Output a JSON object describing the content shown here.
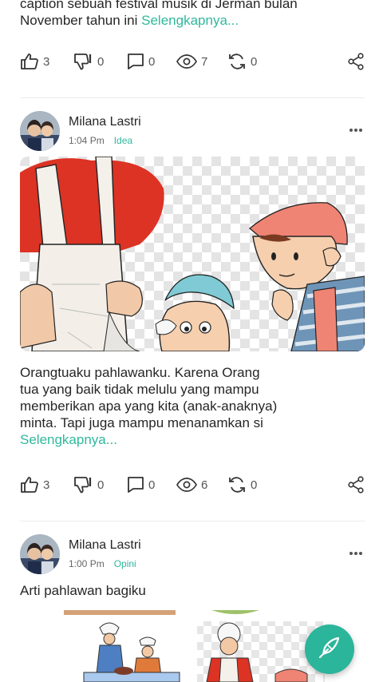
{
  "post1": {
    "caption_top": "caption sebuah festival musik di Jerman bulan",
    "caption_line2": "November tahun ini ",
    "more_label": "Selengkapnya...",
    "stats": {
      "likes": "3",
      "dislikes": "0",
      "comments": "0",
      "views": "7",
      "reposts": "0"
    }
  },
  "post2": {
    "author": "Milana Lastri",
    "time": "1:04 Pm",
    "category": "Idea",
    "body": [
      "Orangtuaku pahlawanku. Karena Orang",
      "tua yang baik tidak melulu yang mampu",
      "memberikan apa yang kita (anak-anaknya)",
      "minta. Tapi juga mampu menanamkan si"
    ],
    "more_label": "Selengkapnya...",
    "stats": {
      "likes": "3",
      "dislikes": "0",
      "comments": "0",
      "views": "6",
      "reposts": "0"
    }
  },
  "post3": {
    "author": "Milana Lastri",
    "time": "1:00 Pm",
    "category": "Opini",
    "title": "Arti pahlawan bagiku"
  },
  "colors": {
    "accent": "#2fb89c",
    "fab": "#2bb59a",
    "text": "#262626",
    "muted": "#555555"
  },
  "icons": [
    "thumbs-up-icon",
    "thumbs-down-icon",
    "comment-icon",
    "eye-icon",
    "repost-icon",
    "share-icon",
    "more-dots-icon",
    "quill-pen-icon"
  ]
}
